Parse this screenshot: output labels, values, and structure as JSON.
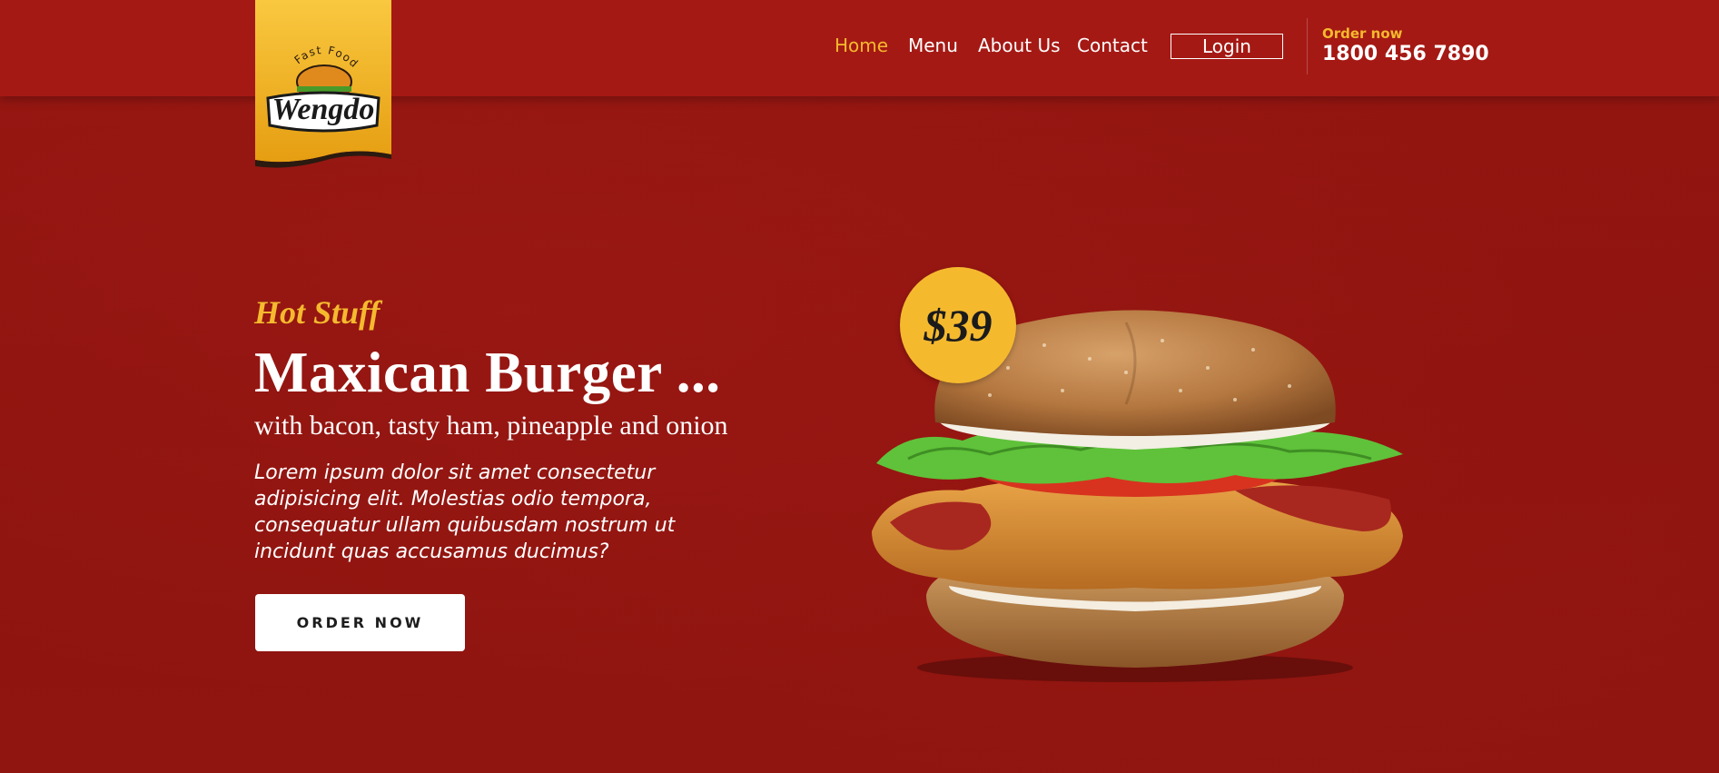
{
  "brand": {
    "logo_tagline": "Fast Food",
    "logo_name": "Wengdo",
    "colors": {
      "primary": "#a51914",
      "accent": "#f5b92e",
      "background": "#8f1410"
    }
  },
  "nav": {
    "items": [
      {
        "label": "Home",
        "active": true
      },
      {
        "label": "Menu",
        "active": false
      },
      {
        "label": "About Us",
        "active": false
      },
      {
        "label": "Contact",
        "active": false
      }
    ],
    "login_label": "Login"
  },
  "order": {
    "label": "Order now",
    "phone": "1800 456 7890"
  },
  "hero": {
    "eyebrow": "Hot Stuff",
    "title": "Maxican Burger ...",
    "subtitle": "with bacon, tasty ham, pineapple and onion",
    "body": "Lorem ipsum dolor sit amet consectetur adipisicing elit. Molestias odio tempora, consequatur ullam quibusdam nostrum ut incidunt quas accusamus ducimus?",
    "cta_label": "ORDER NOW",
    "price": "$39",
    "image_icon": "burger-image"
  }
}
